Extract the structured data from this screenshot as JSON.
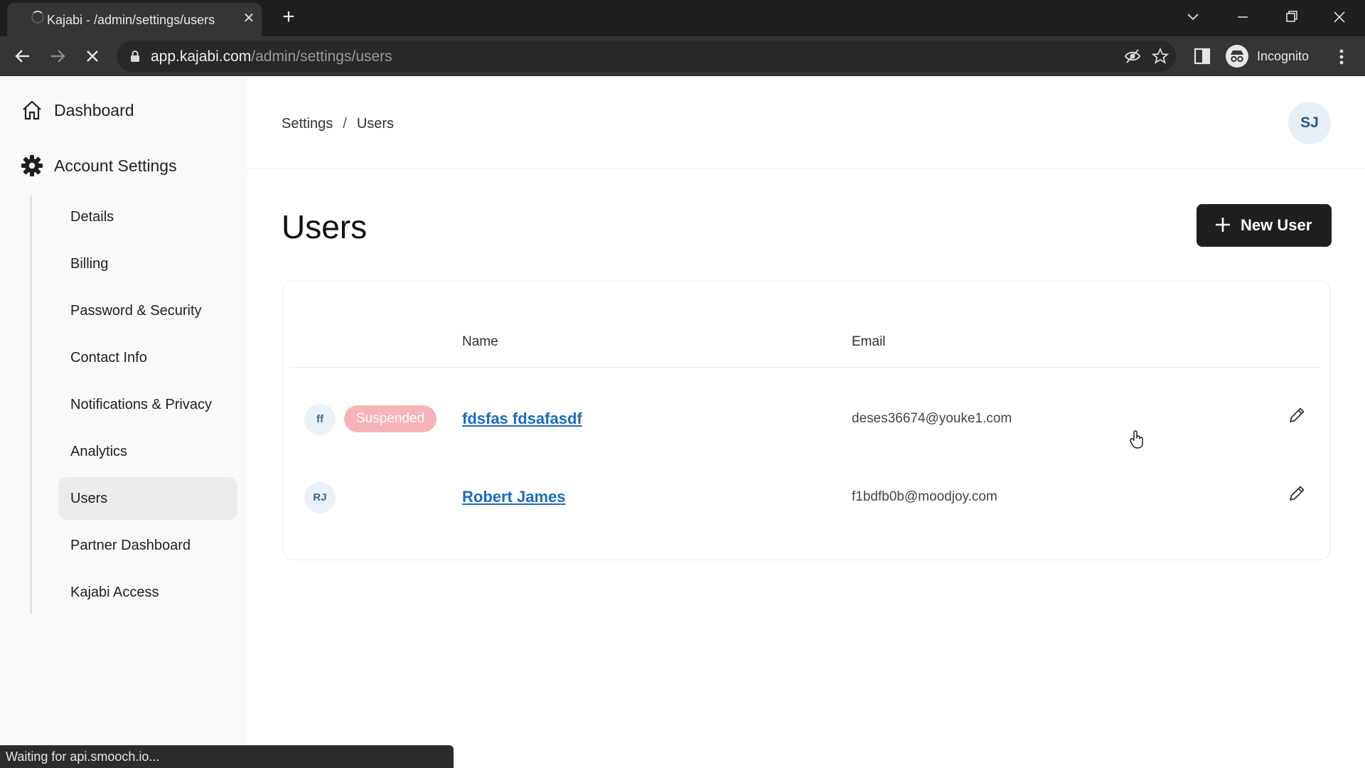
{
  "browser": {
    "tab_title": "Kajabi - /admin/settings/users",
    "url_host": "app.kajabi.com",
    "url_path": "/admin/settings/users",
    "profile_label": "Incognito",
    "status_text": "Waiting for api.smooch.io..."
  },
  "sidebar": {
    "dashboard_label": "Dashboard",
    "account_settings_label": "Account Settings",
    "items": [
      {
        "label": "Details"
      },
      {
        "label": "Billing"
      },
      {
        "label": "Password & Security"
      },
      {
        "label": "Contact Info"
      },
      {
        "label": "Notifications & Privacy"
      },
      {
        "label": "Analytics"
      },
      {
        "label": "Users",
        "active": true
      },
      {
        "label": "Partner Dashboard"
      },
      {
        "label": "Kajabi Access"
      }
    ]
  },
  "header": {
    "breadcrumb": [
      "Settings",
      "/",
      "Users"
    ],
    "avatar_initials": "SJ"
  },
  "main": {
    "title": "Users",
    "new_user_label": "New User",
    "table": {
      "columns": [
        "Name",
        "Email"
      ],
      "rows": [
        {
          "initials": "ff",
          "badge": "Suspended",
          "name": "fdsfas fdsafasdf",
          "email": "deses36674@youke1.com"
        },
        {
          "initials": "RJ",
          "badge": "",
          "name": "Robert James",
          "email": "f1bdfb0b@moodjoy.com"
        }
      ]
    }
  },
  "colors": {
    "accent_link": "#1b6cc2",
    "suspended_badge": "#f7b4b8",
    "primary_button": "#1f1f1f"
  }
}
